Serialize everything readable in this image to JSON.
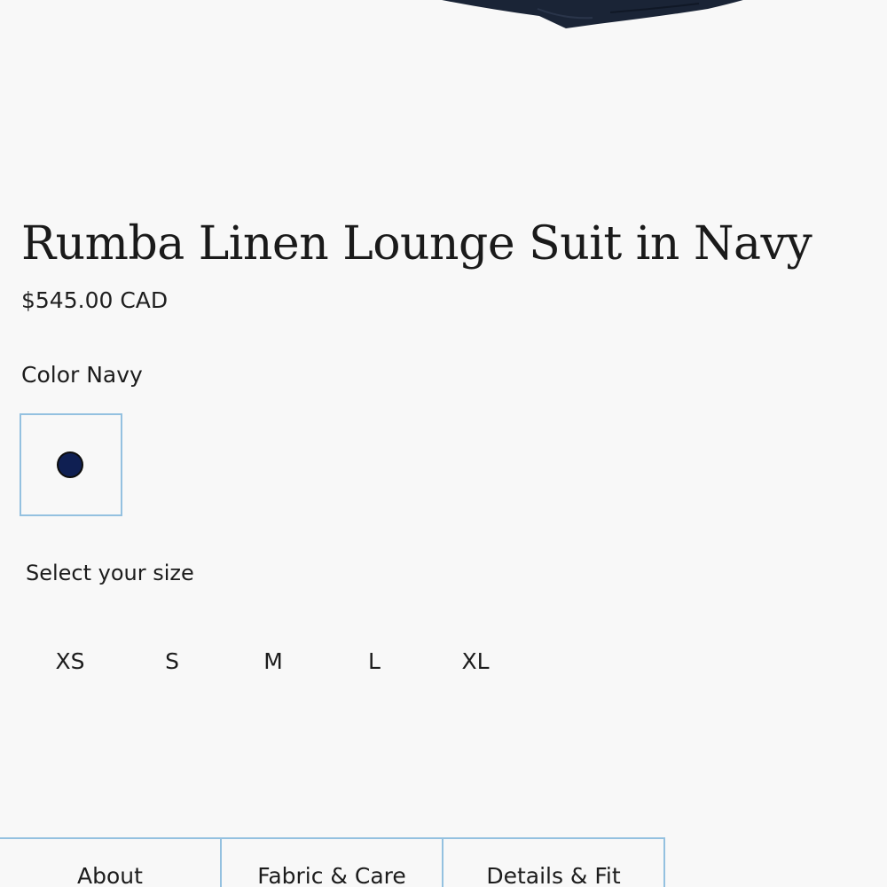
{
  "product": {
    "title": "Rumba Linen Lounge Suit in Navy",
    "price": "$545.00 CAD",
    "image_alt": "Navy linen lounge suit"
  },
  "color": {
    "label": "Color",
    "selected": "Navy",
    "swatches": [
      {
        "name": "Navy",
        "hex": "#0f1f52",
        "selected": true
      }
    ],
    "swatch_border": "#94c1e0"
  },
  "size": {
    "label": "Select your size",
    "options": [
      "XS",
      "S",
      "M",
      "L",
      "XL"
    ]
  },
  "tabs": [
    {
      "label": "About"
    },
    {
      "label": "Fabric & Care"
    },
    {
      "label": "Details & Fit"
    }
  ],
  "colors": {
    "background": "#f8f8f8",
    "text": "#1c1c1c",
    "garment": "#1a2436",
    "accent_border": "#94c1e0"
  }
}
